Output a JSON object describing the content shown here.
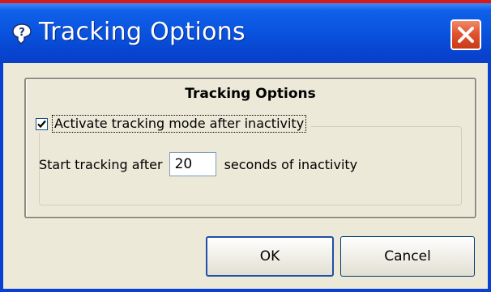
{
  "window": {
    "title": "Tracking Options",
    "title_icon": "help-question-icon",
    "close_icon": "close-x-icon",
    "colors": {
      "titlebar": "#0a55e0",
      "close_button": "#e2532d",
      "dialog_background": "#ece9d8"
    }
  },
  "group": {
    "heading": "Tracking Options",
    "checkbox_label": "Activate tracking mode after inactivity",
    "checkbox_checked": true,
    "start_label": "Start tracking after",
    "seconds_value": "20",
    "seconds_suffix": "seconds of inactivity"
  },
  "buttons": {
    "ok": "OK",
    "cancel": "Cancel"
  }
}
